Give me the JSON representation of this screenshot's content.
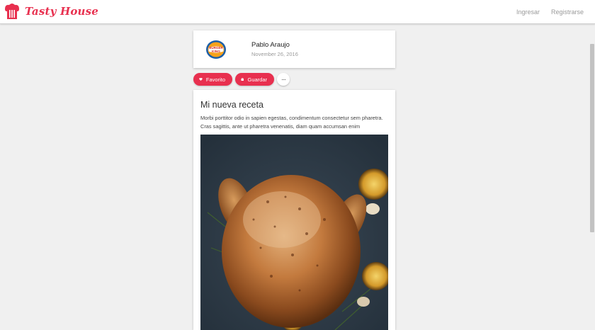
{
  "header": {
    "brand": "Tasty House",
    "nav": [
      {
        "label": "Ingresar"
      },
      {
        "label": "Registrarse"
      }
    ]
  },
  "author": {
    "name": "Pablo Araujo",
    "date": "November 26, 2016",
    "avatar_logo": {
      "line1": "BURGER",
      "line2": "KING"
    }
  },
  "actions": {
    "favorite_label": "Favorito",
    "save_label": "Guardar",
    "more_label": "···"
  },
  "recipe": {
    "title": "Mi nueva receta",
    "description": "Morbi porttitor odio in sapien egestas, condimentum consectetur sem pharetra. Cras sagittis, ante ut pharetra venenatis, diam quam accumsan enim"
  },
  "colors": {
    "accent": "#e8304f"
  }
}
